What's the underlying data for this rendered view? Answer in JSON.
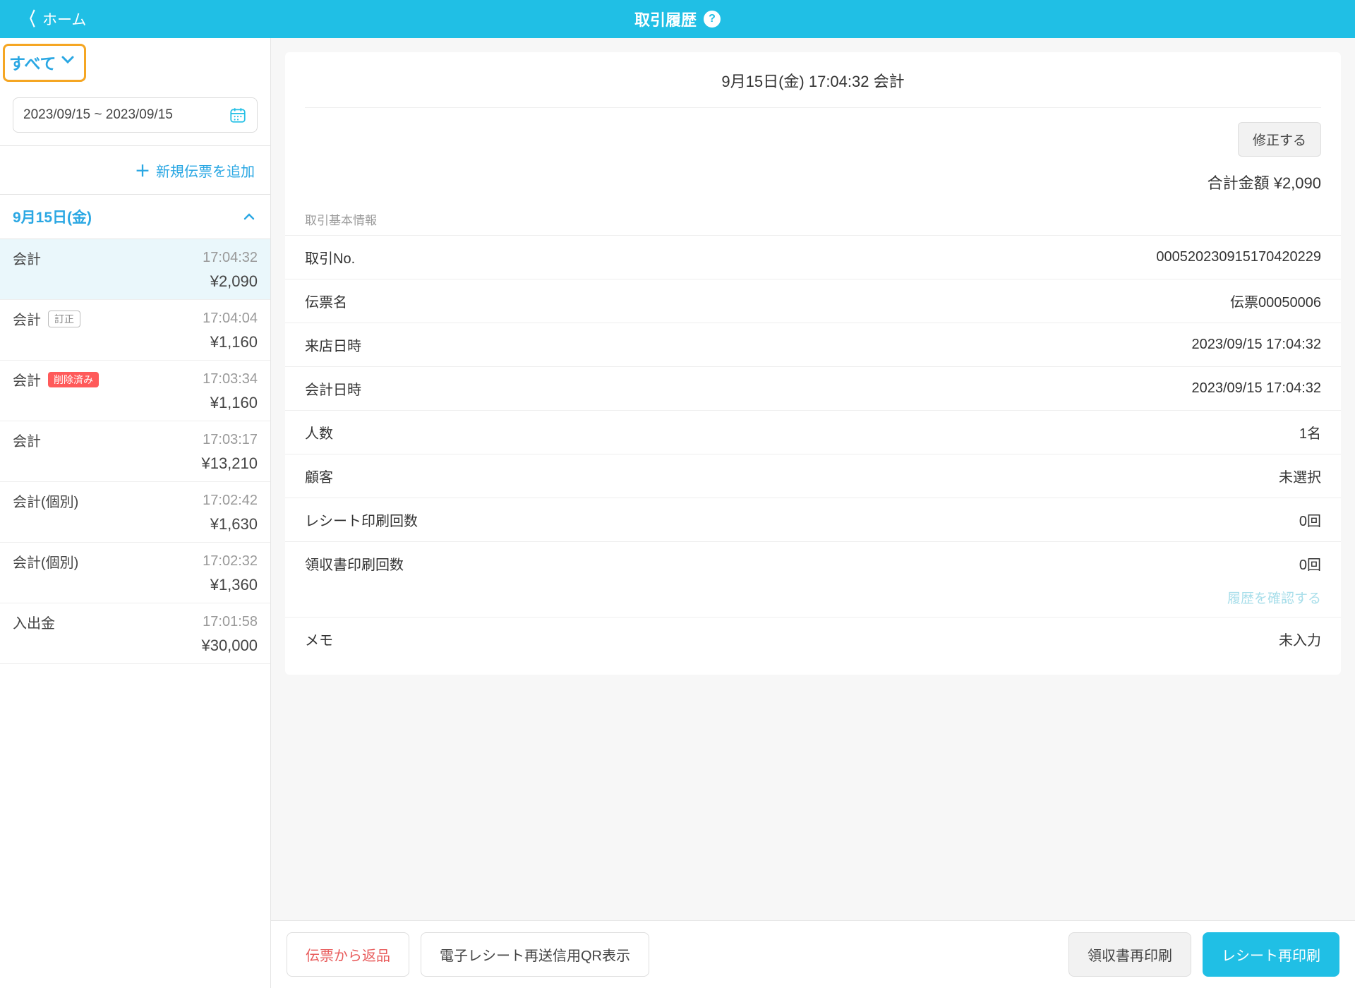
{
  "header": {
    "back_label": "ホーム",
    "title": "取引履歴"
  },
  "sidebar": {
    "filter_label": "すべて",
    "date_range": "2023/09/15 ~ 2023/09/15",
    "add_slip_label": "新規伝票を追加",
    "day_header": "9月15日(金)",
    "transactions": [
      {
        "name": "会計",
        "badge": null,
        "badge_class": "",
        "time": "17:04:32",
        "amount": "¥2,090",
        "selected": true
      },
      {
        "name": "会計",
        "badge": "訂正",
        "badge_class": "outline",
        "time": "17:04:04",
        "amount": "¥1,160",
        "selected": false
      },
      {
        "name": "会計",
        "badge": "削除済み",
        "badge_class": "red",
        "time": "17:03:34",
        "amount": "¥1,160",
        "selected": false
      },
      {
        "name": "会計",
        "badge": null,
        "badge_class": "",
        "time": "17:03:17",
        "amount": "¥13,210",
        "selected": false
      },
      {
        "name": "会計(個別)",
        "badge": null,
        "badge_class": "",
        "time": "17:02:42",
        "amount": "¥1,630",
        "selected": false
      },
      {
        "name": "会計(個別)",
        "badge": null,
        "badge_class": "",
        "time": "17:02:32",
        "amount": "¥1,360",
        "selected": false
      },
      {
        "name": "入出金",
        "badge": null,
        "badge_class": "",
        "time": "17:01:58",
        "amount": "¥30,000",
        "selected": false
      }
    ]
  },
  "detail": {
    "header": "9月15日(金) 17:04:32 会計",
    "edit_label": "修正する",
    "total_label": "合計金額",
    "total_amount": "¥2,090",
    "section_title": "取引基本情報",
    "rows": [
      {
        "label": "取引No.",
        "value": "000520230915170420229"
      },
      {
        "label": "伝票名",
        "value": "伝票00050006"
      },
      {
        "label": "来店日時",
        "value": "2023/09/15 17:04:32"
      },
      {
        "label": "会計日時",
        "value": "2023/09/15 17:04:32"
      },
      {
        "label": "人数",
        "value": "1名"
      },
      {
        "label": "顧客",
        "value": "未選択"
      },
      {
        "label": "レシート印刷回数",
        "value": "0回"
      },
      {
        "label": "領収書印刷回数",
        "value": "0回"
      },
      {
        "label": "メモ",
        "value": "未入力"
      }
    ],
    "history_link": "履歴を確認する"
  },
  "bottom": {
    "return_from_slip": "伝票から返品",
    "qr_reprint": "電子レシート再送信用QR表示",
    "receipt_reprint": "領収書再印刷",
    "print_reprint": "レシート再印刷"
  }
}
